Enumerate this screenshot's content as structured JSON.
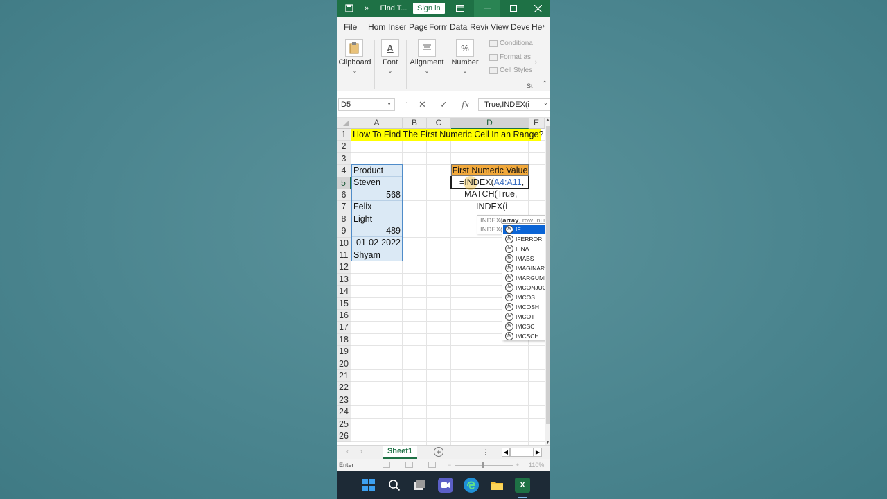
{
  "titlebar": {
    "qat_more": "»",
    "doc_title": "Find T...",
    "sign_in": "Sign in"
  },
  "ribbon_tabs": [
    "File",
    "Hom",
    "Inser",
    "Page",
    "Form",
    "Data",
    "Revie",
    "View",
    "Deve",
    "He"
  ],
  "ribbon_groups": {
    "clipboard": "Clipboard",
    "font": "Font",
    "alignment": "Alignment",
    "number": "Number",
    "number_icon": "%",
    "font_icon": "A",
    "styles_items": [
      "Conditiona",
      "Format as",
      "Cell Styles"
    ],
    "styles_label": "St"
  },
  "formula_bar": {
    "name_box": "D5",
    "cancel": "✕",
    "enter": "✓",
    "fx": "fx",
    "content": "True,INDEX(i"
  },
  "columns": [
    "A",
    "B",
    "C",
    "D",
    "E"
  ],
  "rows": [
    "1",
    "2",
    "3",
    "4",
    "5",
    "6",
    "7",
    "8",
    "9",
    "10",
    "11",
    "12",
    "13",
    "14",
    "15",
    "16",
    "17",
    "18",
    "19",
    "20",
    "21",
    "22",
    "23",
    "24",
    "25",
    "26"
  ],
  "cells": {
    "title": "How To Find The First Numeric Cell In an Range?",
    "a4": "Product",
    "a5": "Steven",
    "a6": "568",
    "a7": "Felix",
    "a8": "Light",
    "a9": "489",
    "a10": "01-02-2022",
    "a11": "Shyam",
    "d4": "First Numeric Value"
  },
  "formula_edit": {
    "line1_prefix": "=INDEX(",
    "line1_ref": "A4:A11",
    "line1_suffix": ",",
    "line2": "MATCH(True,",
    "line3": "INDEX(i"
  },
  "tooltip": {
    "line1_prefix": "INDEX(",
    "line1_bold": "array",
    "line1_rest": ", row_num",
    "line2": "INDEX("
  },
  "autocomplete": [
    "IF",
    "IFERROR",
    "IFNA",
    "IMABS",
    "IMAGINARY",
    "IMARGUMENT",
    "IMCONJUGATE",
    "IMCOS",
    "IMCOSH",
    "IMCOT",
    "IMCSC",
    "IMCSCH"
  ],
  "sheet_tabs": [
    "Sheet1"
  ],
  "status": {
    "mode": "Enter",
    "zoom": "110%"
  },
  "colors": {
    "excel_green": "#1e7145",
    "title_fill": "#ffff00",
    "header_fill": "#f2a93b",
    "selection_fill": "#dbe9f5"
  }
}
